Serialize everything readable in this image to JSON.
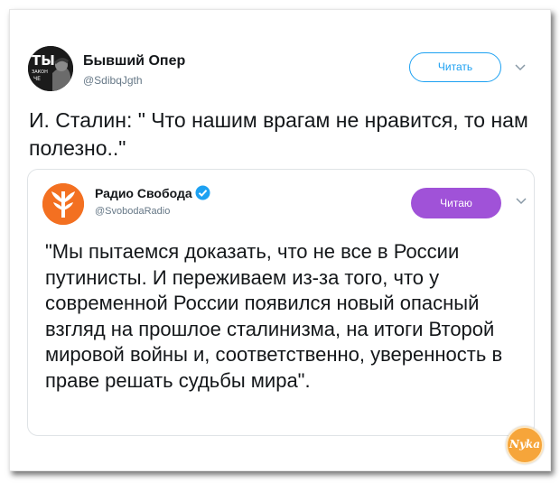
{
  "tweet": {
    "author_name": "Бывший Опер",
    "author_handle": "@SdibqJgth",
    "avatar_icon": "ty-zakon-portrait-icon",
    "follow_label": "Читать",
    "text": "И. Сталин: \" Что нашим врагам не нравится, то нам полезно..\""
  },
  "quoted": {
    "author_name": "Радио Свобода",
    "author_handle": "@SvobodaRadio",
    "avatar_icon": "radio-svoboda-logo-icon",
    "verified_icon": "verified-badge-icon",
    "following_label": "Читаю",
    "text": "\"Мы пытаемся доказать, что не все в России путинисты. И переживаем из-за того, что у современной России появился новый опасный взгляд на прошлое сталинизма, на итоги Второй мировой войны и, соответственно, уверенность в праве решать судьбы мира\"."
  },
  "watermark": {
    "text": "Nyka",
    "icon": "nyka-watermark-icon"
  },
  "colors": {
    "accent": "#1da1f2",
    "following_button": "#a052d8",
    "svoboda_orange": "#f37021",
    "secondary_text": "#657786",
    "watermark": "#f6a53a"
  }
}
